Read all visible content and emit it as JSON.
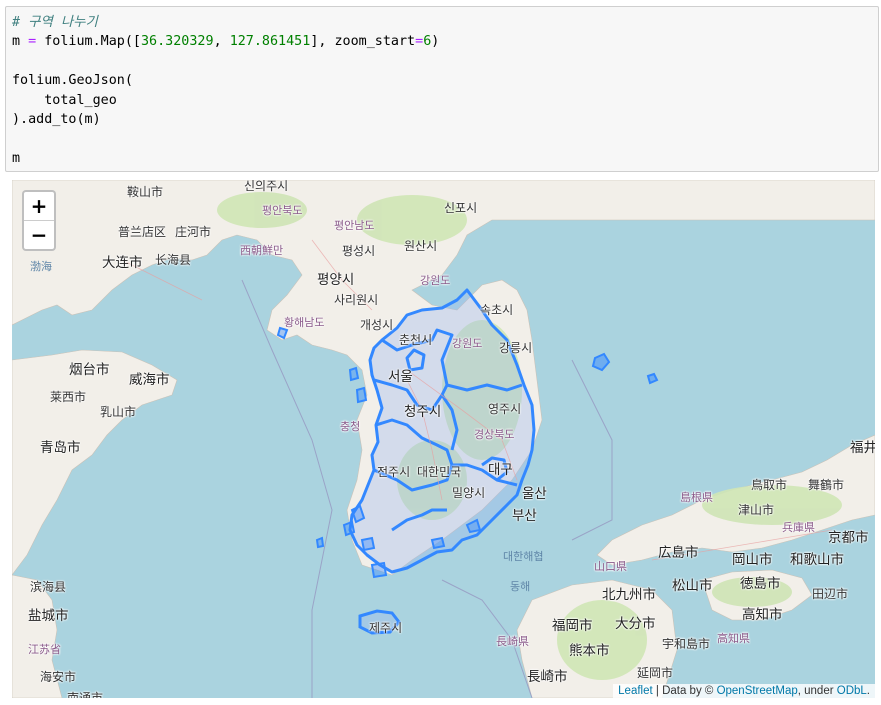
{
  "code_cell": {
    "lines": [
      {
        "id": "l1",
        "tokens": [
          {
            "t": "# 구역 나누기",
            "c": "comment"
          }
        ]
      },
      {
        "id": "l2",
        "tokens": [
          {
            "t": "m ",
            "c": ""
          },
          {
            "t": "=",
            "c": "op"
          },
          {
            "t": " folium.Map([",
            "c": ""
          },
          {
            "t": "36.320329",
            "c": "num"
          },
          {
            "t": ", ",
            "c": ""
          },
          {
            "t": "127.861451",
            "c": "num"
          },
          {
            "t": "], zoom_start",
            "c": ""
          },
          {
            "t": "=",
            "c": "op"
          },
          {
            "t": "6",
            "c": "num"
          },
          {
            "t": ")",
            "c": ""
          }
        ]
      },
      {
        "id": "l3",
        "tokens": []
      },
      {
        "id": "l4",
        "tokens": [
          {
            "t": "folium.GeoJson(",
            "c": ""
          }
        ]
      },
      {
        "id": "l5",
        "tokens": [
          {
            "t": "    total_geo",
            "c": ""
          }
        ]
      },
      {
        "id": "l6",
        "tokens": [
          {
            "t": ").add_to(m)",
            "c": ""
          }
        ]
      },
      {
        "id": "l7",
        "tokens": []
      },
      {
        "id": "l8",
        "tokens": [
          {
            "t": "m",
            "c": ""
          }
        ]
      }
    ]
  },
  "map": {
    "zoom_in_label": "+",
    "zoom_out_label": "−",
    "attribution": {
      "leaflet": "Leaflet",
      "sep1": " | Data by © ",
      "osm": "OpenStreetMap",
      "sep2": ", under ",
      "odbl": "ODbL",
      "end": "."
    },
    "colors": {
      "sea": "#aad3df",
      "land": "#f2efe9",
      "green": "#cfe5b5",
      "border": "#3388ff",
      "province_fill": "#9ab8f0"
    },
    "place_labels": [
      {
        "id": "p1",
        "text": "신의주시"
      },
      {
        "id": "p2",
        "text": "평안북도"
      },
      {
        "id": "p3",
        "text": "평안남도"
      },
      {
        "id": "p4",
        "text": "평성시"
      },
      {
        "id": "p5",
        "text": "원산시"
      },
      {
        "id": "p6",
        "text": "평양시"
      },
      {
        "id": "p7",
        "text": "강원도"
      },
      {
        "id": "p8",
        "text": "사리원시"
      },
      {
        "id": "p9",
        "text": "황해남도"
      },
      {
        "id": "p10",
        "text": "개성시"
      },
      {
        "id": "p11",
        "text": "속초시"
      },
      {
        "id": "p12",
        "text": "춘천시"
      },
      {
        "id": "p13",
        "text": "강원도"
      },
      {
        "id": "p14",
        "text": "강릉시"
      },
      {
        "id": "p15",
        "text": "서울"
      },
      {
        "id": "p16",
        "text": "청주시"
      },
      {
        "id": "p17",
        "text": "영주시"
      },
      {
        "id": "p18",
        "text": "충청"
      },
      {
        "id": "p19",
        "text": "경상북도"
      },
      {
        "id": "p20",
        "text": "대구"
      },
      {
        "id": "p21",
        "text": "전주시"
      },
      {
        "id": "p22",
        "text": "대한민국"
      },
      {
        "id": "p23",
        "text": "울산"
      },
      {
        "id": "p24",
        "text": "밀양시"
      },
      {
        "id": "p25",
        "text": "부산"
      },
      {
        "id": "p26",
        "text": "제주시"
      },
      {
        "id": "p27",
        "text": "신포시"
      },
      {
        "id": "p28",
        "text": "大连市"
      },
      {
        "id": "p29",
        "text": "长海县"
      },
      {
        "id": "p30",
        "text": "普兰店区"
      },
      {
        "id": "p31",
        "text": "庄河市"
      },
      {
        "id": "p32",
        "text": "烟台市"
      },
      {
        "id": "p33",
        "text": "威海市"
      },
      {
        "id": "p34",
        "text": "青岛市"
      },
      {
        "id": "p35",
        "text": "莱西市"
      },
      {
        "id": "p36",
        "text": "乳山市"
      },
      {
        "id": "p37",
        "text": "盐城市"
      },
      {
        "id": "p38",
        "text": "南通市"
      },
      {
        "id": "p39",
        "text": "鞍山市"
      },
      {
        "id": "p40",
        "text": "福井"
      },
      {
        "id": "p41",
        "text": "鳥取市"
      },
      {
        "id": "p42",
        "text": "舞鶴市"
      },
      {
        "id": "p43",
        "text": "島根県"
      },
      {
        "id": "p44",
        "text": "津山市"
      },
      {
        "id": "p45",
        "text": "兵庫県"
      },
      {
        "id": "p46",
        "text": "広島市"
      },
      {
        "id": "p47",
        "text": "岡山市"
      },
      {
        "id": "p48",
        "text": "和歌山市"
      },
      {
        "id": "p49",
        "text": "京都市"
      },
      {
        "id": "p50",
        "text": "山口県"
      },
      {
        "id": "p51",
        "text": "松山市"
      },
      {
        "id": "p52",
        "text": "徳島市"
      },
      {
        "id": "p53",
        "text": "北九州市"
      },
      {
        "id": "p54",
        "text": "高知市"
      },
      {
        "id": "p55",
        "text": "田辺市"
      },
      {
        "id": "p56",
        "text": "福岡市"
      },
      {
        "id": "p57",
        "text": "大分市"
      },
      {
        "id": "p58",
        "text": "宇和島市"
      },
      {
        "id": "p59",
        "text": "高知県"
      },
      {
        "id": "p60",
        "text": "長崎県"
      },
      {
        "id": "p61",
        "text": "熊本市"
      },
      {
        "id": "p62",
        "text": "長崎市"
      },
      {
        "id": "p63",
        "text": "延岡市"
      },
      {
        "id": "p64",
        "text": "西朝鮮만"
      },
      {
        "id": "p65",
        "text": "渤海"
      },
      {
        "id": "p66",
        "text": "대한해협"
      },
      {
        "id": "p67",
        "text": "동해"
      },
      {
        "id": "p68",
        "text": "江苏省"
      },
      {
        "id": "p69",
        "text": "滨海县"
      },
      {
        "id": "p70",
        "text": "海安市"
      }
    ]
  }
}
